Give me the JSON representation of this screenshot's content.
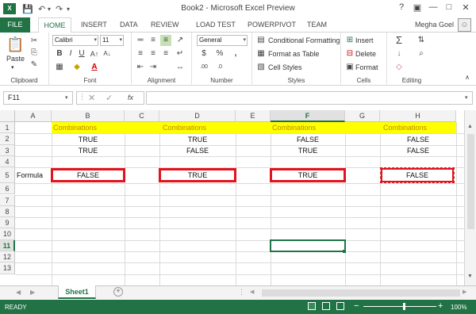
{
  "title": "Book2 - Microsoft Excel Preview",
  "user": "Megha Goel",
  "app_logo": "X",
  "tabs": [
    "FILE",
    "HOME",
    "INSERT",
    "DATA",
    "REVIEW",
    "LOAD TEST",
    "POWERPIVOT",
    "TEAM"
  ],
  "ribbon": {
    "paste_label": "Paste",
    "font_name": "Calibri",
    "font_size": "11",
    "number_format": "General",
    "conditional_formatting": "Conditional Formatting",
    "format_as_table": "Format as Table",
    "cell_styles": "Cell Styles",
    "insert": "Insert",
    "delete": "Delete",
    "format": "Format",
    "groups": [
      "Clipboard",
      "Font",
      "Alignment",
      "Number",
      "Styles",
      "Cells",
      "Editing"
    ]
  },
  "formula_bar": {
    "name_box": "F11",
    "fx": "fx",
    "formula": ""
  },
  "grid": {
    "columns": [
      "A",
      "B",
      "C",
      "D",
      "E",
      "F",
      "G",
      "H"
    ],
    "rows": [
      "1",
      "2",
      "3",
      "4",
      "5",
      "6",
      "7",
      "8",
      "9",
      "10",
      "11",
      "12",
      "13"
    ],
    "selected_column": "F",
    "selected_row": "11"
  },
  "cells": {
    "b1": "Combinations",
    "d1": "Combinations",
    "f1": "Combinations",
    "h1": "Combinations",
    "b2": "TRUE",
    "d2": "TRUE",
    "f2": "FALSE",
    "h2": "FALSE",
    "b3": "TRUE",
    "d3": "FALSE",
    "f3": "TRUE",
    "h3": "FALSE",
    "a5": "Formula",
    "b5": "FALSE",
    "d5": "TRUE",
    "f5": "TRUE",
    "h5": "FALSE"
  },
  "sheet_tab": "Sheet1",
  "status": {
    "ready": "READY",
    "zoom": "100%"
  },
  "colors": {
    "excel_green": "#217346",
    "highlight_yellow": "#ffff00",
    "box_red": "#e1141d"
  }
}
